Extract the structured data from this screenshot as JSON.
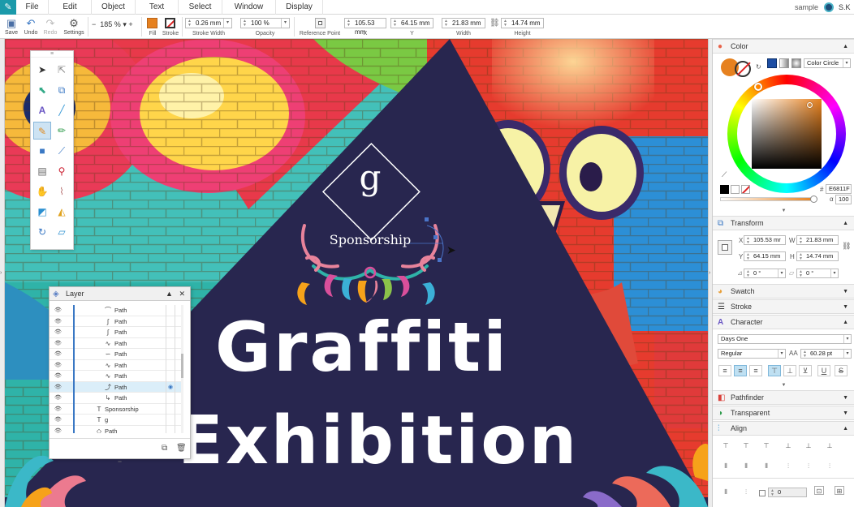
{
  "menubar": {
    "items": [
      "File",
      "Edit",
      "Object",
      "Text",
      "Select",
      "Window",
      "Display"
    ],
    "file_name": "sample",
    "user": "S.K"
  },
  "toolbar": {
    "save": "Save",
    "undo": "Undo",
    "redo": "Redo",
    "settings": "Settings",
    "zoom": "185 %",
    "fill": "Fill",
    "stroke": "Stroke",
    "stroke_width": "0.26 mm",
    "stroke_width_label": "Stroke Width",
    "opacity": "100 %",
    "opacity_label": "Opacity",
    "reference_point_label": "Reference Point",
    "x": "105.53 mm",
    "x_label": "X",
    "y": "64.15 mm",
    "y_label": "Y",
    "width": "21.83 mm",
    "width_label": "Width",
    "height": "14.74 mm",
    "height_label": "Height",
    "fill_color": "#E6811F"
  },
  "artwork": {
    "monogram": "g",
    "sponsor": "Sponsorship",
    "title_line1": "Graffiti",
    "title_line2": "Exhibition"
  },
  "layer_panel": {
    "title": "Layer",
    "rows": [
      {
        "icon": "⌒",
        "label": "Path",
        "indent": 2,
        "selected": false
      },
      {
        "icon": "∫",
        "label": "Path",
        "indent": 2,
        "selected": false
      },
      {
        "icon": "∫",
        "label": "Path",
        "indent": 2,
        "selected": false
      },
      {
        "icon": "∿",
        "label": "Path",
        "indent": 2,
        "selected": false
      },
      {
        "icon": "∽",
        "label": "Path",
        "indent": 2,
        "selected": false
      },
      {
        "icon": "∿",
        "label": "Path",
        "indent": 2,
        "selected": false
      },
      {
        "icon": "∿",
        "label": "Path",
        "indent": 2,
        "selected": false
      },
      {
        "icon": "⤴",
        "label": "Path",
        "indent": 2,
        "selected": true
      },
      {
        "icon": "↳",
        "label": "Path",
        "indent": 2,
        "selected": false
      },
      {
        "icon": "T",
        "label": "Sponsorship",
        "indent": 1,
        "selected": false
      },
      {
        "icon": "T",
        "label": "g",
        "indent": 1,
        "selected": false
      },
      {
        "icon": "◇",
        "label": "Path",
        "indent": 1,
        "selected": false
      }
    ]
  },
  "right_panel": {
    "color": {
      "title": "Color",
      "mode": "Color Circle",
      "hex_label": "#",
      "hex": "E6811F",
      "alpha_label": "α",
      "alpha": "100",
      "current": "#E6811F"
    },
    "transform": {
      "title": "Transform",
      "x_label": "X",
      "x": "105.53 mr",
      "w_label": "W",
      "w": "21.83 mm",
      "y_label": "Y",
      "y": "64.15 mm",
      "h_label": "H",
      "h": "14.74 mm",
      "rotate": "0 °",
      "shear": "0 °"
    },
    "swatch": "Swatch",
    "stroke": "Stroke",
    "character": {
      "title": "Character",
      "font": "Days One",
      "style": "Regular",
      "size": "60.28 pt"
    },
    "pathfinder": "Pathfinder",
    "transparent": "Transparent",
    "align": {
      "title": "Align",
      "spacing": "0"
    }
  }
}
